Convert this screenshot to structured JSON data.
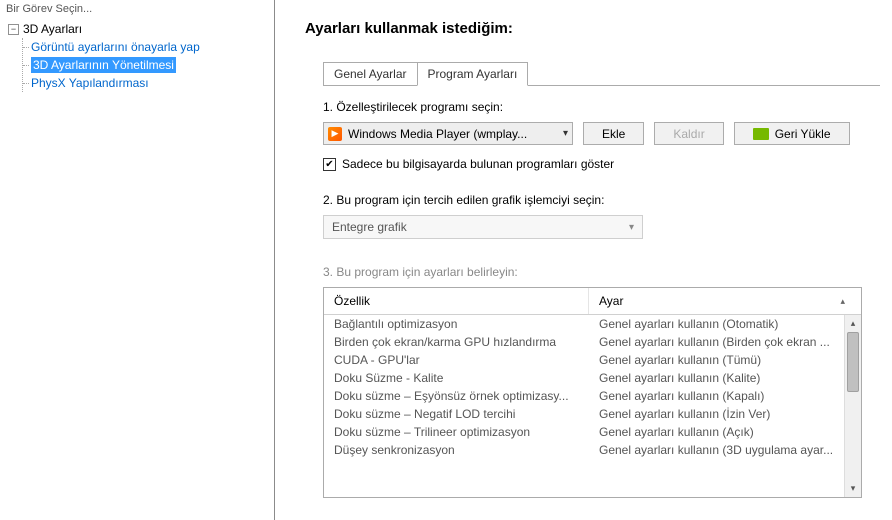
{
  "sidebar": {
    "header": "Bir Görev Seçin...",
    "root": "3D Ayarları",
    "items": [
      "Görüntü ayarlarını önayarla yap",
      "3D Ayarlarının Yönetilmesi",
      "PhysX Yapılandırması"
    ]
  },
  "main": {
    "title": "Ayarları kullanmak istediğim:",
    "tabs": {
      "global": "Genel Ayarlar",
      "program": "Program Ayarları"
    },
    "step1": {
      "label": "1. Özelleştirilecek programı seçin:",
      "selected": "Windows Media Player (wmplay...",
      "add": "Ekle",
      "remove": "Kaldır",
      "restore": "Geri Yükle",
      "checkbox_label": "Sadece bu bilgisayarda bulunan programları göster"
    },
    "step2": {
      "label": "2. Bu program için tercih edilen grafik işlemciyi seçin:",
      "selected": "Entegre grafik"
    },
    "step3": {
      "label": "3. Bu program için ayarları belirleyin:",
      "col_feature": "Özellik",
      "col_setting": "Ayar",
      "rows": [
        {
          "feature": "Bağlantılı optimizasyon",
          "setting": "Genel ayarları kullanın (Otomatik)"
        },
        {
          "feature": "Birden çok ekran/karma GPU hızlandırma",
          "setting": "Genel ayarları kullanın (Birden çok ekran ..."
        },
        {
          "feature": "CUDA - GPU'lar",
          "setting": "Genel ayarları kullanın (Tümü)"
        },
        {
          "feature": "Doku Süzme - Kalite",
          "setting": "Genel ayarları kullanın (Kalite)"
        },
        {
          "feature": "Doku süzme – Eşyönsüz örnek optimizasy...",
          "setting": "Genel ayarları kullanın (Kapalı)"
        },
        {
          "feature": "Doku süzme – Negatif LOD tercihi",
          "setting": "Genel ayarları kullanın (İzin Ver)"
        },
        {
          "feature": "Doku süzme – Trilineer optimizasyon",
          "setting": "Genel ayarları kullanın (Açık)"
        },
        {
          "feature": "Düşey senkronizasyon",
          "setting": "Genel ayarları kullanın (3D uygulama ayar..."
        }
      ]
    }
  }
}
